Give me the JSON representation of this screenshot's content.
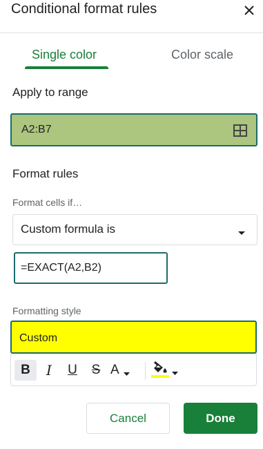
{
  "dialog": {
    "title": "Conditional format rules"
  },
  "tabs": [
    {
      "label": "Single color",
      "selected": true
    },
    {
      "label": "Color scale",
      "selected": false
    }
  ],
  "apply_range": {
    "label": "Apply to range",
    "value": "A2:B7"
  },
  "format_rules": {
    "label": "Format rules",
    "condition_label": "Format cells if…",
    "condition_value": "Custom formula is",
    "formula_value": "=EXACT(A2,B2)"
  },
  "formatting_style": {
    "label": "Formatting style",
    "preview_text": "Custom",
    "fill_color": "#ffff00"
  },
  "toolbar": {
    "bold": "B",
    "italic": "I",
    "underline": "U",
    "strikethrough": "S",
    "text_color": "A",
    "icons": [
      "bold-icon",
      "italic-icon",
      "underline-icon",
      "strikethrough-icon",
      "text-color-icon",
      "fill-color-icon"
    ]
  },
  "actions": {
    "cancel": "Cancel",
    "done": "Done"
  },
  "colors": {
    "accent_green": "#188038",
    "range_fill": "#acc57f",
    "focus_border": "#1a6b6b"
  }
}
